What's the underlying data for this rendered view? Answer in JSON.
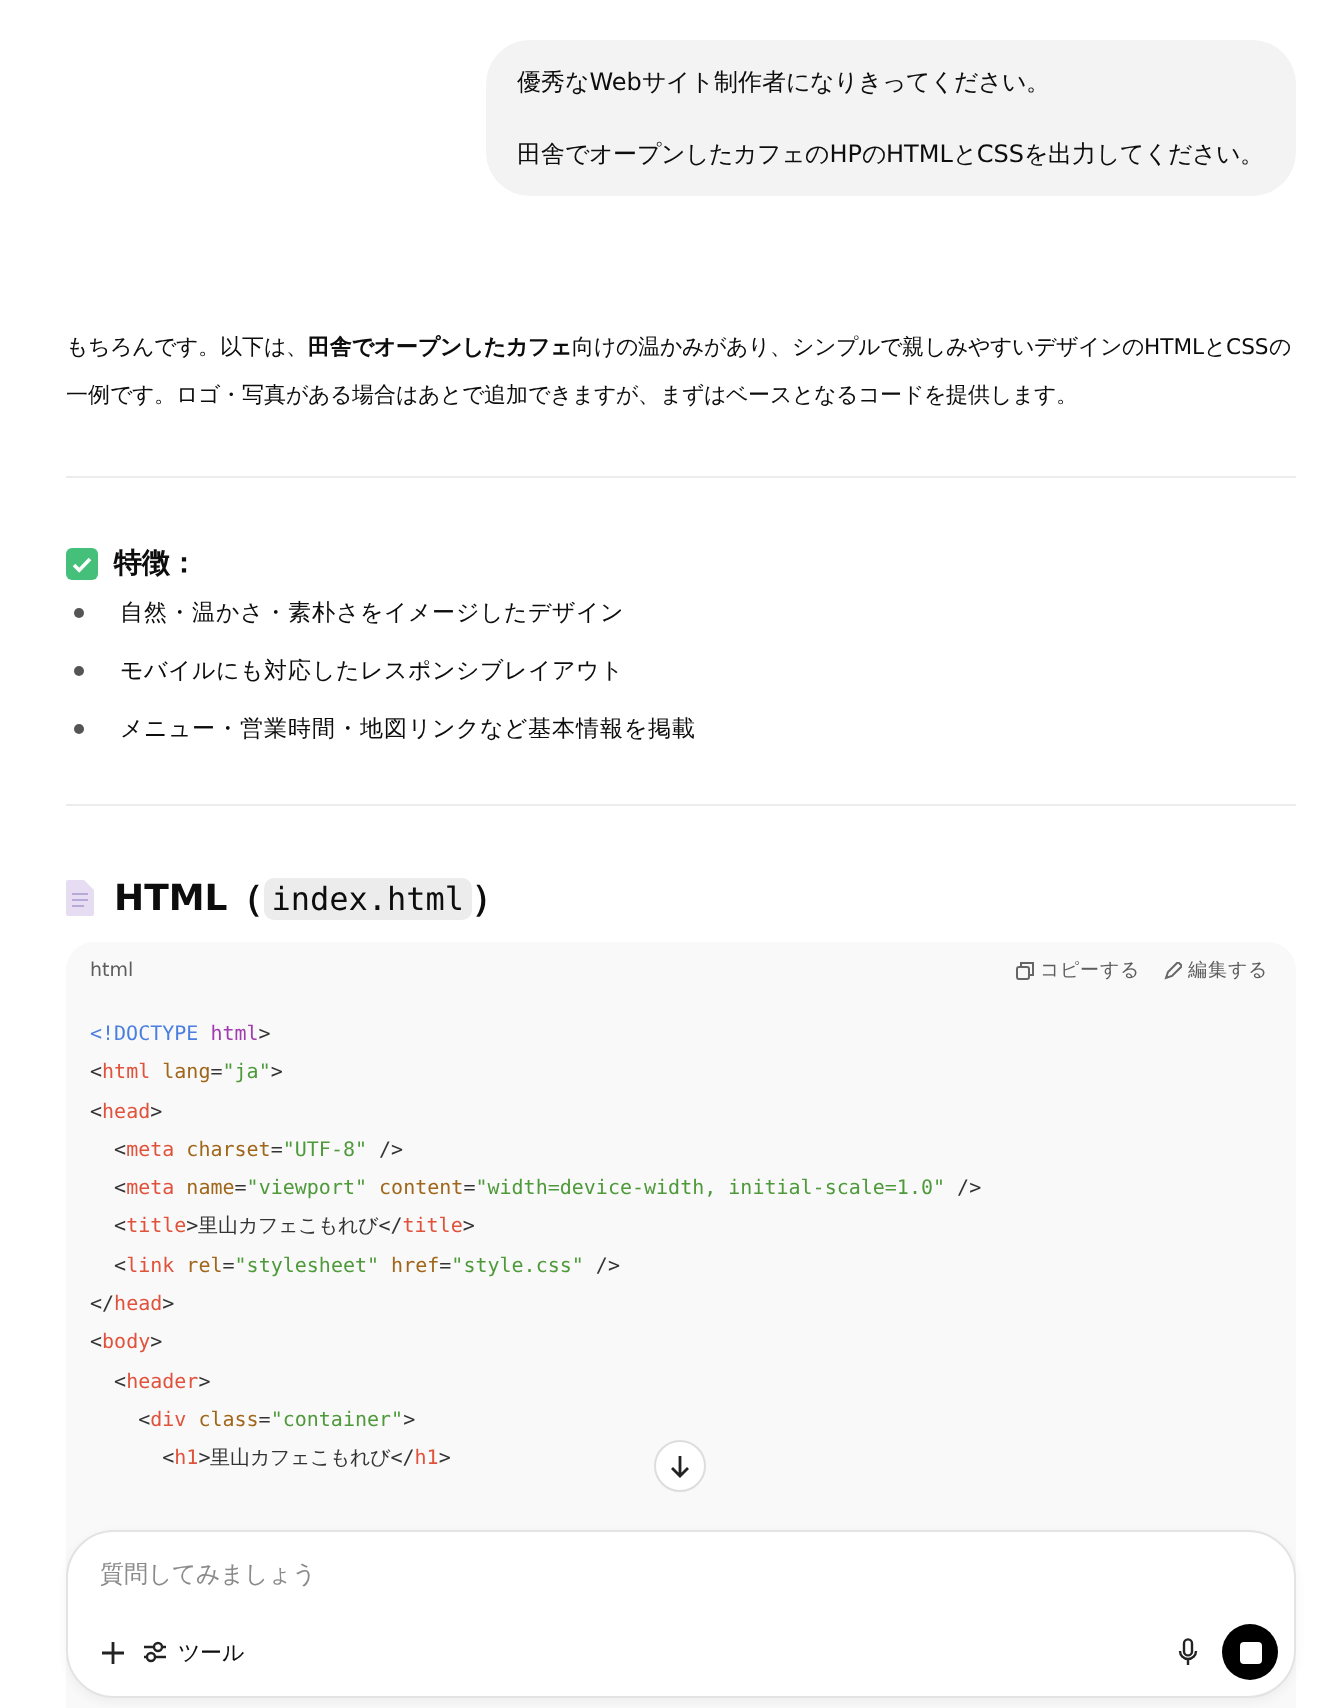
{
  "user_message": {
    "lines": [
      "優秀なWebサイト制作者になりきってください。",
      "田舎でオープンしたカフェのHPのHTMLとCSSを出力してください。"
    ]
  },
  "reply": {
    "intro": "もちろんです。以下は、**田舎でオープンしたカフェ**向けの温かみがあり、シンプルで親しみやすいデザインのHTMLとCSSの一例です。ロゴ・写真がある場合はあとで追加できますが、まずはベースとなるコードを提供します。",
    "features": {
      "heading": "特徴：",
      "items": [
        "自然・温かさ・素朴さをイメージしたデザイン",
        "モバイルにも対応したレスポンシブレイアウト",
        "メニュー・営業時間・地図リンクなど基本情報を掲載"
      ]
    },
    "code_section": {
      "heading": "HTML（",
      "filename": "index.html",
      "heading_end": "）"
    },
    "code_block": {
      "language": "html",
      "copy_label": "コピーする",
      "edit_label": "編集する",
      "lines": [
        [
          {
            "kind": "doctype",
            "text": "<!DOCTYPE"
          },
          {
            "kind": "keyword",
            "text": " html"
          },
          {
            "kind": "punct",
            "text": ">"
          }
        ],
        [
          {
            "kind": "punct",
            "text": "<"
          },
          {
            "kind": "tag",
            "text": "html"
          },
          {
            "kind": "attr",
            "text": " lang"
          },
          {
            "kind": "punct",
            "text": "="
          },
          {
            "kind": "string",
            "text": "\"ja\""
          },
          {
            "kind": "punct",
            "text": ">"
          }
        ],
        [
          {
            "kind": "punct",
            "text": "<"
          },
          {
            "kind": "tag",
            "text": "head"
          },
          {
            "kind": "punct",
            "text": ">"
          }
        ],
        [
          {
            "kind": "punct",
            "text": "  <"
          },
          {
            "kind": "tag",
            "text": "meta"
          },
          {
            "kind": "attr",
            "text": " charset"
          },
          {
            "kind": "punct",
            "text": "="
          },
          {
            "kind": "string",
            "text": "\"UTF-8\""
          },
          {
            "kind": "punct",
            "text": " />"
          }
        ],
        [
          {
            "kind": "punct",
            "text": "  <"
          },
          {
            "kind": "tag",
            "text": "meta"
          },
          {
            "kind": "attr",
            "text": " name"
          },
          {
            "kind": "punct",
            "text": "="
          },
          {
            "kind": "string",
            "text": "\"viewport\""
          },
          {
            "kind": "attr",
            "text": " content"
          },
          {
            "kind": "punct",
            "text": "="
          },
          {
            "kind": "string",
            "text": "\"width=device-width, initial-scale=1.0\""
          },
          {
            "kind": "punct",
            "text": " />"
          }
        ],
        [
          {
            "kind": "punct",
            "text": "  <"
          },
          {
            "kind": "tag",
            "text": "title"
          },
          {
            "kind": "punct",
            "text": ">"
          },
          {
            "kind": "plain",
            "text": "里山カフェこもれび"
          },
          {
            "kind": "punct",
            "text": "</"
          },
          {
            "kind": "tag",
            "text": "title"
          },
          {
            "kind": "punct",
            "text": ">"
          }
        ],
        [
          {
            "kind": "punct",
            "text": "  <"
          },
          {
            "kind": "tag",
            "text": "link"
          },
          {
            "kind": "attr",
            "text": " rel"
          },
          {
            "kind": "punct",
            "text": "="
          },
          {
            "kind": "string",
            "text": "\"stylesheet\""
          },
          {
            "kind": "attr",
            "text": " href"
          },
          {
            "kind": "punct",
            "text": "="
          },
          {
            "kind": "string",
            "text": "\"style.css\""
          },
          {
            "kind": "punct",
            "text": " />"
          }
        ],
        [
          {
            "kind": "punct",
            "text": "</"
          },
          {
            "kind": "tag",
            "text": "head"
          },
          {
            "kind": "punct",
            "text": ">"
          }
        ],
        [
          {
            "kind": "punct",
            "text": "<"
          },
          {
            "kind": "tag",
            "text": "body"
          },
          {
            "kind": "punct",
            "text": ">"
          }
        ],
        [
          {
            "kind": "punct",
            "text": "  <"
          },
          {
            "kind": "tag",
            "text": "header"
          },
          {
            "kind": "punct",
            "text": ">"
          }
        ],
        [
          {
            "kind": "punct",
            "text": "    <"
          },
          {
            "kind": "tag",
            "text": "div"
          },
          {
            "kind": "attr",
            "text": " class"
          },
          {
            "kind": "punct",
            "text": "="
          },
          {
            "kind": "string",
            "text": "\"container\""
          },
          {
            "kind": "punct",
            "text": ">"
          }
        ],
        [
          {
            "kind": "punct",
            "text": "      <"
          },
          {
            "kind": "tag",
            "text": "h1"
          },
          {
            "kind": "punct",
            "text": ">"
          },
          {
            "kind": "plain",
            "text": "里山カフェこもれび"
          },
          {
            "kind": "punct",
            "text": "</"
          },
          {
            "kind": "tag",
            "text": "h1"
          },
          {
            "kind": "punct",
            "text": ">"
          }
        ]
      ]
    }
  },
  "composer": {
    "placeholder": "質問してみましょう",
    "tools_label": "ツール"
  }
}
